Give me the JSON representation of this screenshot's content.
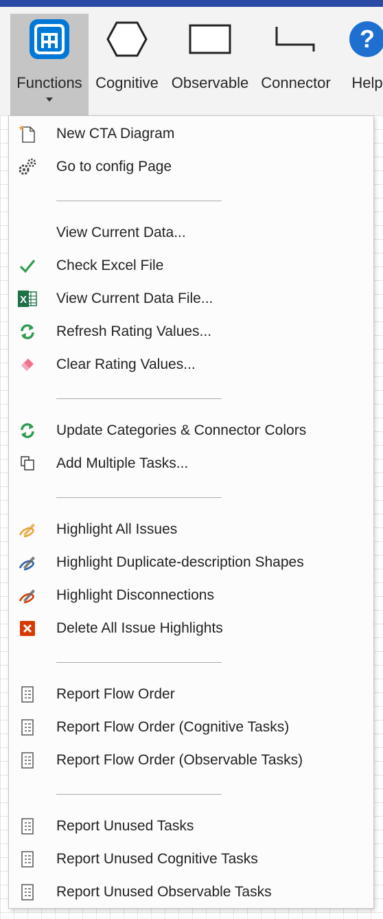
{
  "colors": {
    "title_bar": "#2b4aa6",
    "accent_blue": "#0078d7",
    "green": "#2e9c4f",
    "excel_green": "#1e7145",
    "red": "#d83b01",
    "pink": "#f0728a",
    "orange": "#e8a23c"
  },
  "ribbon": {
    "buttons": [
      {
        "id": "functions",
        "label": "Functions",
        "icon": "functions-icon",
        "has_dropdown": true,
        "active": true
      },
      {
        "id": "cognitive",
        "label": "Cognitive",
        "icon": "hexagon-icon"
      },
      {
        "id": "observable",
        "label": "Observable",
        "icon": "rectangle-icon"
      },
      {
        "id": "connector",
        "label": "Connector",
        "icon": "connector-icon"
      },
      {
        "id": "help",
        "label": "Help",
        "icon": "help-icon"
      }
    ]
  },
  "menu": {
    "items": [
      {
        "label": "New CTA Diagram",
        "icon": "new-document-icon"
      },
      {
        "label": "Go to config Page",
        "icon": "gears-icon"
      },
      {
        "label": "View Current Data...",
        "icon": ""
      },
      {
        "label": "Check Excel File",
        "icon": "checkmark-icon"
      },
      {
        "label": "View Current Data File...",
        "icon": "excel-icon"
      },
      {
        "label": "Refresh Rating Values...",
        "icon": "refresh-icon"
      },
      {
        "label": "Clear Rating Values...",
        "icon": "eraser-icon"
      },
      {
        "label": "Update Categories & Connector Colors",
        "icon": "refresh-icon"
      },
      {
        "label": "Add Multiple Tasks...",
        "icon": "copy-icon"
      },
      {
        "label": "Highlight All Issues",
        "icon": "highlight-orange-icon"
      },
      {
        "label": "Highlight Duplicate-description Shapes",
        "icon": "highlight-blue-icon"
      },
      {
        "label": "Highlight Disconnections",
        "icon": "highlight-red-icon"
      },
      {
        "label": "Delete All Issue Highlights",
        "icon": "delete-icon"
      },
      {
        "label": "Report Flow Order",
        "icon": "report-icon"
      },
      {
        "label": "Report Flow Order (Cognitive Tasks)",
        "icon": "report-icon"
      },
      {
        "label": "Report Flow Order (Observable Tasks)",
        "icon": "report-icon"
      },
      {
        "label": "Report Unused Tasks",
        "icon": "report-icon"
      },
      {
        "label": "Report Unused Cognitive Tasks",
        "icon": "report-icon"
      },
      {
        "label": "Report Unused Observable Tasks",
        "icon": "report-icon"
      }
    ]
  }
}
